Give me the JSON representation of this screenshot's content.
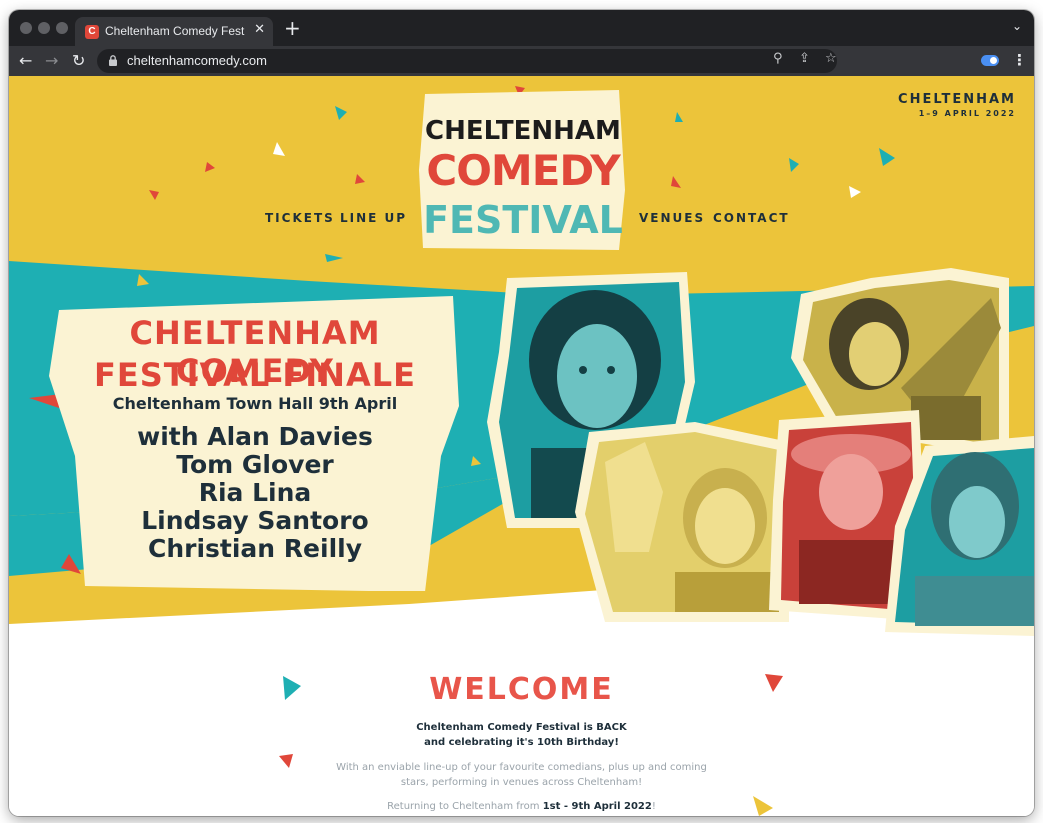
{
  "browser": {
    "tab_title": "Cheltenham Comedy Festival:",
    "tab_favicon_letter": "C",
    "url": "cheltenhamcomedy.com",
    "new_tab_glyph": "+",
    "close_glyph": "✕",
    "tab_menu_glyph": "⌄",
    "back_glyph": "←",
    "forward_glyph": "→",
    "reload_glyph": "↻",
    "zoom_glyph": "⚲",
    "share_glyph": "⇪",
    "bookmark_glyph": "☆",
    "menu_glyph": "⋮"
  },
  "logo": {
    "line1": "CHELTENHAM",
    "line2": "COMEDY",
    "line3": "FESTIVAL"
  },
  "top_right": {
    "city": "CHELTENHAM",
    "dates": "1–9 APRIL 2022"
  },
  "nav": {
    "tickets": "TICKETS",
    "lineup": "LINE UP",
    "venues": "VENUES",
    "contact": "CONTACT"
  },
  "finale": {
    "title_line1": "CHELTENHAM COMEDY",
    "title_line2": "FESTIVAL FINALE",
    "venue": "Cheltenham Town Hall 9th April",
    "lineup": [
      "with Alan Davies",
      "Tom Glover",
      "Ria Lina",
      "Lindsay Santoro",
      "Christian Reilly"
    ]
  },
  "welcome": {
    "title": "WELCOME",
    "strong_line1": "Cheltenham Comedy Festival is BACK",
    "strong_line2": "and celebrating it's 10th Birthday!",
    "body_line1": "With an enviable line-up of your favourite comedians, plus up and coming",
    "body_line2": "stars, performing in venues across Cheltenham!",
    "returning_prefix": "Returning to Cheltenham from ",
    "returning_dates": "1st - 9th April 2022",
    "returning_suffix": "!"
  },
  "colors": {
    "mustard": "#ecc43a",
    "teal": "#1eafb3",
    "red": "#e0473a",
    "cream": "#fbf3d3",
    "navy": "#1e2f3a"
  },
  "icons": {
    "lock": "lock-icon",
    "extension": "toggle-extension-icon"
  }
}
